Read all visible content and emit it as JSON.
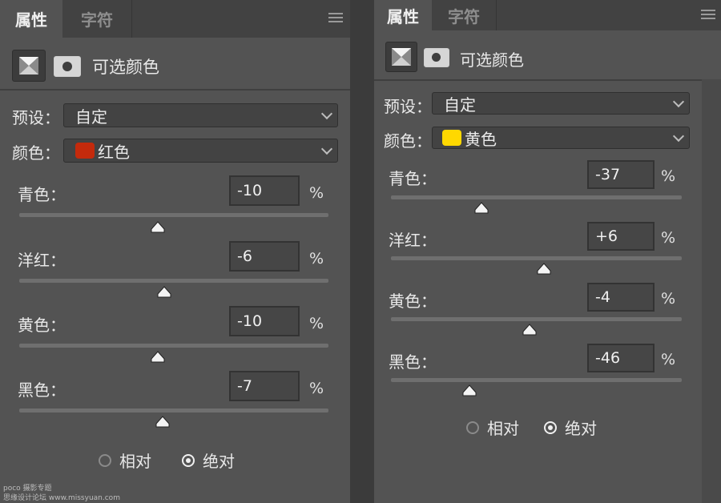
{
  "panels": [
    {
      "tabs": [
        {
          "label": "属性",
          "active": true
        },
        {
          "label": "字符",
          "active": false
        }
      ],
      "title": "可选颜色",
      "preset_label": "预设：",
      "preset_value": "自定",
      "color_label": "颜色：",
      "color_value": "红色",
      "color_swatch": "#c42a0c",
      "sliders": [
        {
          "label": "青色：",
          "value": "-10",
          "unit": "%",
          "level": -10
        },
        {
          "label": "洋红：",
          "value": "-6",
          "unit": "%",
          "level": -6
        },
        {
          "label": "黄色：",
          "value": "-10",
          "unit": "%",
          "level": -10
        },
        {
          "label": "黑色：",
          "value": "-7",
          "unit": "%",
          "level": -7
        }
      ],
      "method": [
        {
          "label": "相对",
          "selected": false
        },
        {
          "label": "绝对",
          "selected": true
        }
      ]
    },
    {
      "tabs": [
        {
          "label": "属性",
          "active": true
        },
        {
          "label": "字符",
          "active": false
        }
      ],
      "title": "可选颜色",
      "preset_label": "预设：",
      "preset_value": "自定",
      "color_label": "颜色：",
      "color_value": "黄色",
      "color_swatch": "#ffd800",
      "sliders": [
        {
          "label": "青色：",
          "value": "-37",
          "unit": "%",
          "level": -37
        },
        {
          "label": "洋红：",
          "value": "+6",
          "unit": "%",
          "level": 6
        },
        {
          "label": "黄色：",
          "value": "-4",
          "unit": "%",
          "level": -4
        },
        {
          "label": "黑色：",
          "value": "-46",
          "unit": "%",
          "level": -46
        }
      ],
      "method": [
        {
          "label": "相对",
          "selected": false
        },
        {
          "label": "绝对",
          "selected": true
        }
      ]
    }
  ],
  "watermark": {
    "line1": "poco 摄影专题",
    "line2": "思缘设计论坛 www.missyuan.com"
  }
}
